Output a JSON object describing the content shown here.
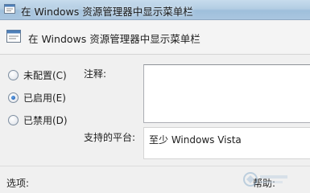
{
  "window": {
    "title": "在 Windows 资源管理器中显示菜单栏",
    "icon": "policy-setting-icon"
  },
  "header": {
    "title": "在 Windows 资源管理器中显示菜单栏",
    "icon": "policy-setting-icon"
  },
  "options": [
    {
      "label": "未配置(C)",
      "checked": false
    },
    {
      "label": "已启用(E)",
      "checked": true
    },
    {
      "label": "已禁用(D)",
      "checked": false
    }
  ],
  "comment": {
    "label": "注释:",
    "value": ""
  },
  "supported": {
    "label": "支持的平台:",
    "value": "至少 Windows Vista"
  },
  "bottom": {
    "options_label": "选项:",
    "help_label": "帮助:"
  },
  "colors": {
    "titlebar": "#b3cde3",
    "accent": "#1f5fb4",
    "window_bg": "#f0f0f0"
  }
}
